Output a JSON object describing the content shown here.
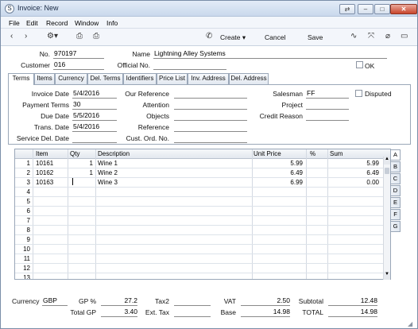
{
  "window": {
    "title": "Invoice: New",
    "app_icon": "S"
  },
  "menu": [
    "File",
    "Edit",
    "Record",
    "Window",
    "Info"
  ],
  "toolbar": {
    "create_label": "Create",
    "cancel_label": "Cancel",
    "save_label": "Save"
  },
  "header": {
    "no_label": "No.",
    "no_value": "970197",
    "name_label": "Name",
    "name_value": "Lightning Alley Systems",
    "customer_label": "Customer",
    "customer_value": "016",
    "official_label": "Official No.",
    "official_value": "",
    "ok_label": "OK"
  },
  "tabs": [
    "Terms",
    "Items",
    "Currency",
    "Del. Terms",
    "Identifiers",
    "Price List",
    "Inv. Address",
    "Del. Address"
  ],
  "terms": {
    "invoice_date_label": "Invoice Date",
    "invoice_date": "5/4/2016",
    "payment_terms_label": "Payment Terms",
    "payment_terms": "30",
    "due_date_label": "Due Date",
    "due_date": "5/5/2016",
    "trans_date_label": "Trans. Date",
    "trans_date": "5/4/2016",
    "service_del_label": "Service Del. Date",
    "service_del": "",
    "our_ref_label": "Our Reference",
    "our_ref": "",
    "attention_label": "Attention",
    "attention": "",
    "objects_label": "Objects",
    "objects": "",
    "reference_label": "Reference",
    "reference": "",
    "cust_ord_label": "Cust. Ord. No.",
    "cust_ord": "",
    "salesman_label": "Salesman",
    "salesman": "FF",
    "project_label": "Project",
    "project": "",
    "credit_label": "Credit Reason",
    "credit": "",
    "disputed_label": "Disputed"
  },
  "grid": {
    "headers": [
      "Item",
      "Qty",
      "Description",
      "Unit Price",
      "%",
      "Sum"
    ],
    "rows": [
      {
        "n": "1",
        "item": "10161",
        "qty": "1",
        "desc": "Wine 1",
        "price": "5.99",
        "pct": "",
        "sum": "5.99"
      },
      {
        "n": "2",
        "item": "10162",
        "qty": "1",
        "desc": "Wine 2",
        "price": "6.49",
        "pct": "",
        "sum": "6.49"
      },
      {
        "n": "3",
        "item": "10163",
        "qty": "",
        "desc": "Wine 3",
        "price": "6.99",
        "pct": "",
        "sum": "0.00"
      },
      {
        "n": "4",
        "item": "",
        "qty": "",
        "desc": "",
        "price": "",
        "pct": "",
        "sum": ""
      },
      {
        "n": "5",
        "item": "",
        "qty": "",
        "desc": "",
        "price": "",
        "pct": "",
        "sum": ""
      },
      {
        "n": "6",
        "item": "",
        "qty": "",
        "desc": "",
        "price": "",
        "pct": "",
        "sum": ""
      },
      {
        "n": "7",
        "item": "",
        "qty": "",
        "desc": "",
        "price": "",
        "pct": "",
        "sum": ""
      },
      {
        "n": "8",
        "item": "",
        "qty": "",
        "desc": "",
        "price": "",
        "pct": "",
        "sum": ""
      },
      {
        "n": "9",
        "item": "",
        "qty": "",
        "desc": "",
        "price": "",
        "pct": "",
        "sum": ""
      },
      {
        "n": "10",
        "item": "",
        "qty": "",
        "desc": "",
        "price": "",
        "pct": "",
        "sum": ""
      },
      {
        "n": "11",
        "item": "",
        "qty": "",
        "desc": "",
        "price": "",
        "pct": "",
        "sum": ""
      },
      {
        "n": "12",
        "item": "",
        "qty": "",
        "desc": "",
        "price": "",
        "pct": "",
        "sum": ""
      },
      {
        "n": "13",
        "item": "",
        "qty": "",
        "desc": "",
        "price": "",
        "pct": "",
        "sum": ""
      }
    ],
    "card_tabs": [
      "A",
      "B",
      "C",
      "D",
      "E",
      "F",
      "G"
    ]
  },
  "footer": {
    "currency_label": "Currency",
    "currency": "GBP",
    "gp_pct_label": "GP %",
    "gp_pct": "27.2",
    "total_gp_label": "Total GP",
    "total_gp": "3.40",
    "tax2_label": "Tax2",
    "tax2": "",
    "ext_tax_label": "Ext. Tax",
    "ext_tax": "",
    "vat_label": "VAT",
    "vat": "2.50",
    "base_label": "Base",
    "base": "14.98",
    "subtotal_label": "Subtotal",
    "subtotal": "12.48",
    "total_label": "TOTAL",
    "total": "14.98"
  },
  "colors": {
    "titlebar": "#c9d8ec",
    "close": "#c9462c",
    "frame": "#9aa7b8"
  }
}
